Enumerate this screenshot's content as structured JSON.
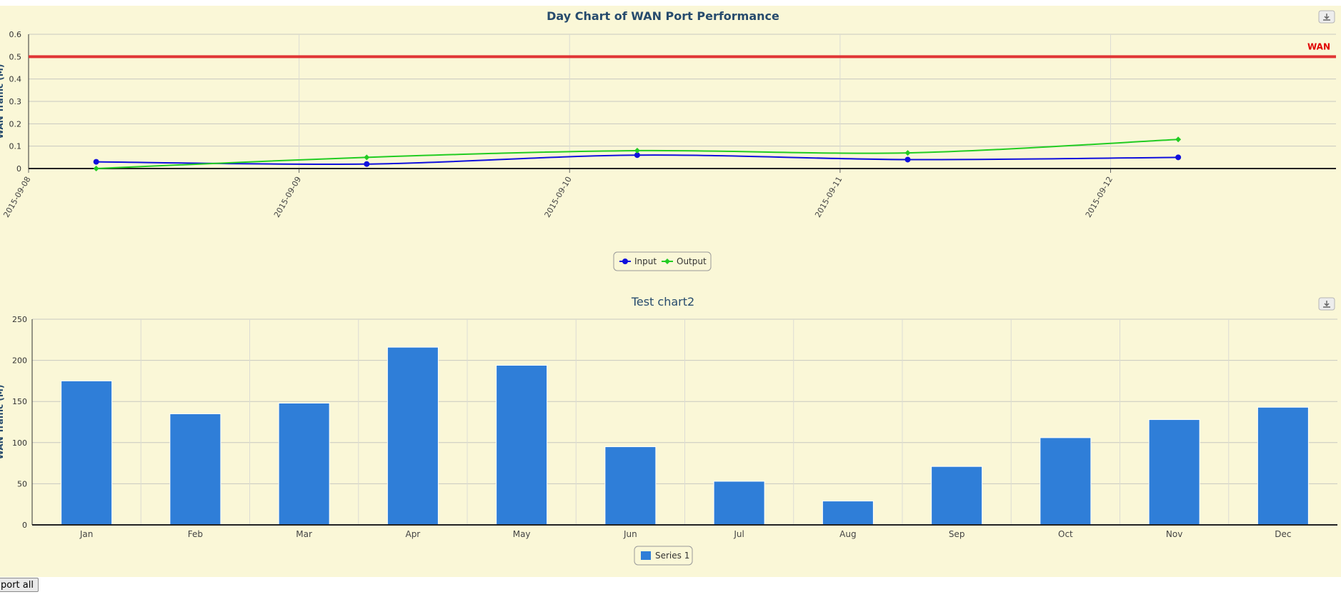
{
  "colors": {
    "background": "#faf7d7",
    "input": "#1010dd",
    "output": "#22cc22",
    "wan_line": "#e03535",
    "bar": "#2f7ed8",
    "title": "#274b6d"
  },
  "toolbar": {
    "export_all_label": "port all"
  },
  "chart_data": [
    {
      "type": "line",
      "title": "Day Chart of WAN Port Performance",
      "ylabel": "WAN Traffic (M)",
      "ylim": [
        0,
        0.6
      ],
      "yticks": [
        "0",
        "0.1",
        "0.2",
        "0.3",
        "0.4",
        "0.5",
        "0.6"
      ],
      "xlim": [
        "2015-09-08",
        "2015-09-12T20:00"
      ],
      "xticks": [
        "2015-09-08",
        "2015-09-09",
        "2015-09-10",
        "2015-09-11",
        "2015-09-12"
      ],
      "plot_lines": [
        {
          "label": "WAN",
          "value": 0.5
        }
      ],
      "series": [
        {
          "name": "Input",
          "x": [
            "2015-09-08T06:00",
            "2015-09-09T06:00",
            "2015-09-10T06:00",
            "2015-09-11T06:00",
            "2015-09-12T06:00"
          ],
          "values": [
            0.03,
            0.02,
            0.06,
            0.04,
            0.05
          ]
        },
        {
          "name": "Output",
          "x": [
            "2015-09-08T06:00",
            "2015-09-09T06:00",
            "2015-09-10T06:00",
            "2015-09-11T06:00",
            "2015-09-12T06:00"
          ],
          "values": [
            0.0,
            0.05,
            0.08,
            0.07,
            0.13
          ]
        }
      ],
      "legend": "bottom-center",
      "grid": true,
      "export_icon": "download-icon"
    },
    {
      "type": "bar",
      "title": "Test chart2",
      "ylabel": "WAN Traffic (M)",
      "ylim": [
        0,
        250
      ],
      "yticks": [
        "0",
        "50",
        "100",
        "150",
        "200",
        "250"
      ],
      "categories": [
        "Jan",
        "Feb",
        "Mar",
        "Apr",
        "May",
        "Jun",
        "Jul",
        "Aug",
        "Sep",
        "Oct",
        "Nov",
        "Dec"
      ],
      "series": [
        {
          "name": "Series 1",
          "values": [
            175,
            135,
            148,
            216,
            194,
            95,
            53,
            29,
            71,
            106,
            128,
            143
          ]
        }
      ],
      "legend": "bottom-center",
      "grid": true,
      "export_icon": "download-icon"
    }
  ]
}
